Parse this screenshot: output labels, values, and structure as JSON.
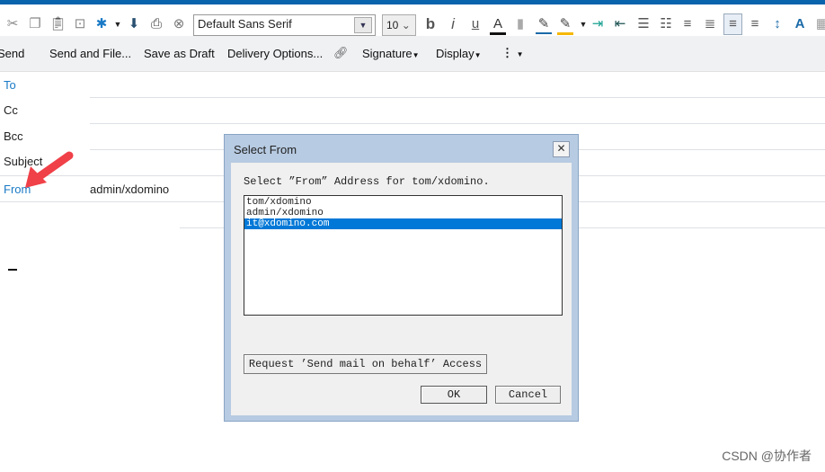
{
  "toolbar": {
    "font": "Default Sans Serif",
    "size": "10",
    "icons": [
      "cut-icon",
      "copy-icon",
      "paste-icon",
      "link-icon",
      "new-icon",
      "dropdown-icon",
      "save-icon",
      "print-icon",
      "cancel-icon",
      "bold-icon",
      "italic-icon",
      "underline-icon",
      "text-color-icon",
      "paint-icon",
      "pen-icon",
      "highlight-icon",
      "indent-icon",
      "outdent-icon",
      "bullets-icon",
      "numbering-icon",
      "align-center-icon",
      "justify-icon",
      "align-left-icon",
      "align-right-icon",
      "line-spacing-icon",
      "font-style-icon",
      "table-icon"
    ]
  },
  "actions": {
    "send": "Send",
    "send_file": "Send and File...",
    "draft": "Save as Draft",
    "delivery": "Delivery Options...",
    "signature": "Signature",
    "display": "Display"
  },
  "fields": {
    "to": "To",
    "cc": "Cc",
    "bcc": "Bcc",
    "subject": "Subject",
    "from": "From",
    "from_value": "admin/xdomino"
  },
  "dialog": {
    "title": "Select From",
    "prompt": "Select ”From” Address for tom/xdomino.",
    "options": [
      "tom/xdomino",
      "admin/xdomino",
      "it@xdomino.com"
    ],
    "selected": "it@xdomino.com",
    "request": "Request ’Send mail on behalf’ Access",
    "ok": "OK",
    "cancel": "Cancel"
  },
  "watermark": "CSDN @协作者",
  "colors": {
    "accent": "#0a63ad",
    "selection": "#0078d7",
    "arrow": "#f04048",
    "label_link": "#1a7ac6"
  }
}
